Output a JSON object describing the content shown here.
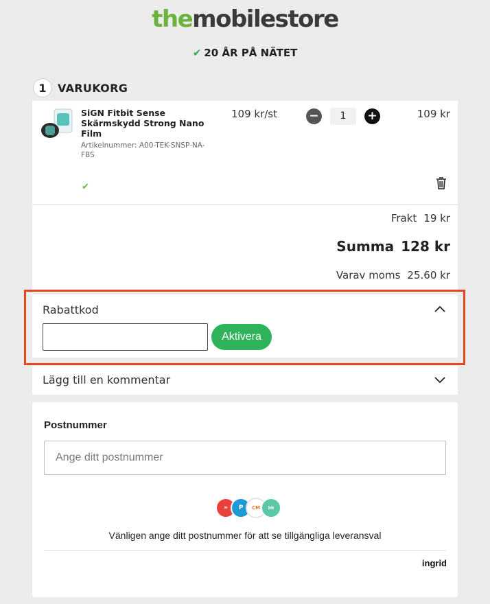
{
  "header": {
    "logo_prefix": "the",
    "logo_suffix": "mobilestore",
    "tagline_check": "✔",
    "tagline": "20 ÅR PÅ NÄTET"
  },
  "step": {
    "number": "1",
    "label": "VARUKORG"
  },
  "cart": {
    "item": {
      "name": "SiGN Fitbit Sense Skärmskydd Strong Nano Film",
      "sku": "Artikelnummer: A00-TEK-SNSP-NA-FBS",
      "unit_price": "109 kr/st",
      "quantity": "1",
      "line_total": "109 kr",
      "minus": "−",
      "plus": "+",
      "stock_check": "✔"
    }
  },
  "summary": {
    "shipping_label": "Frakt",
    "shipping_value": "19 kr",
    "total_label": "Summa",
    "total_value": "128 kr",
    "vat_label": "Varav moms",
    "vat_value": "25.60 kr"
  },
  "discount": {
    "title": "Rabattkod",
    "input_value": "",
    "button_label": "Aktivera"
  },
  "comment": {
    "title": "Lägg till en kommentar"
  },
  "shipping": {
    "label": "Postnummer",
    "placeholder": "Ange ditt postnummer",
    "carriers": [
      "Instabox",
      "PostNord",
      "City Mail",
      "budbee"
    ],
    "hint": "Vänligen ange ditt postnummer för att se tillgängliga leveransval",
    "provider": "ingrid"
  },
  "colors": {
    "brand_green": "#6cb33e",
    "button_green": "#2fb35a",
    "highlight": "#e4471c"
  }
}
